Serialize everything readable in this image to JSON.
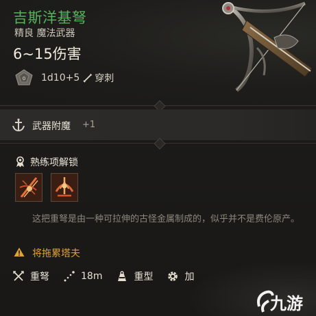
{
  "item": {
    "name": "吉斯洋基弩",
    "rarity_type": "精良 魔法武器",
    "damage": "6~15伤害",
    "dice": "1d10+5",
    "damage_type": "穿刺",
    "name_color": "#56b35c"
  },
  "enchant": {
    "label": "武器附魔",
    "bonus": "+1"
  },
  "proficiency": {
    "label": "熟练项解锁",
    "actions": [
      {
        "icon": "slashing-strike-icon"
      },
      {
        "icon": "brace-shot-icon"
      }
    ]
  },
  "description": "这把重弩是由一种可拉伸的古怪金属制成的，似乎并不是费伦原产。",
  "warning": {
    "text": "将拖累塔夫",
    "color": "#e0a233"
  },
  "properties": [
    {
      "icon": "crossed-bolts-icon",
      "label": "重弩"
    },
    {
      "icon": "range-icon",
      "label": "18m"
    },
    {
      "icon": "heavy-icon",
      "label": "重型"
    },
    {
      "icon": "gear-icon",
      "label": "加"
    }
  ],
  "watermark": {
    "text": "九游"
  }
}
